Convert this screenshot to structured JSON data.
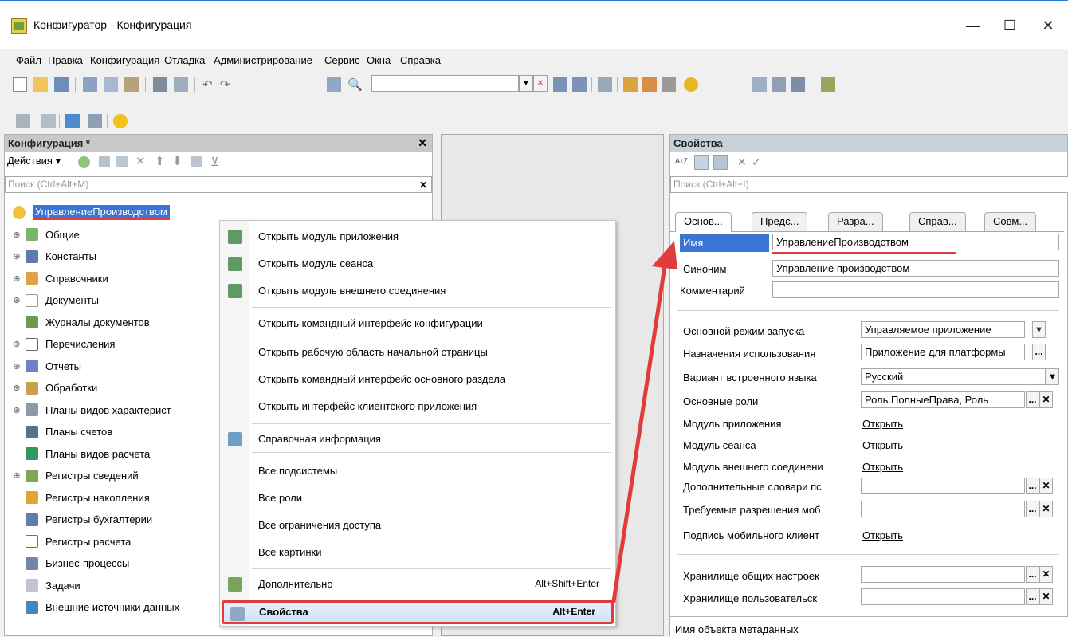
{
  "window": {
    "title": "Конфигуратор - Конфигурация",
    "minimize": "—",
    "maximize": "☐",
    "close": "✕"
  },
  "menu": [
    "Файл",
    "Правка",
    "Конфигурация",
    "Отладка",
    "Администрирование",
    "Сервис",
    "Окна",
    "Справка"
  ],
  "left": {
    "title": "Конфигурация *",
    "actions": "Действия ▾",
    "search_placeholder": "Поиск (Ctrl+Alt+M)",
    "root": "УправлениеПроизводством",
    "items": [
      "Общие",
      "Константы",
      "Справочники",
      "Документы",
      "Журналы документов",
      "Перечисления",
      "Отчеты",
      "Обработки",
      "Планы видов характерист",
      "Планы счетов",
      "Планы видов расчета",
      "Регистры сведений",
      "Регистры накопления",
      "Регистры бухгалтерии",
      "Регистры расчета",
      "Бизнес-процессы",
      "Задачи",
      "Внешние источники данных"
    ]
  },
  "context_menu": {
    "items": [
      {
        "label": "Открыть модуль приложения"
      },
      {
        "label": "Открыть модуль сеанса"
      },
      {
        "label": "Открыть модуль внешнего соединения"
      },
      {
        "label": "Открыть командный интерфейс конфигурации"
      },
      {
        "label": "Открыть рабочую область начальной страницы"
      },
      {
        "label": "Открыть командный интерфейс основного раздела"
      },
      {
        "label": "Открыть интерфейс клиентского приложения"
      },
      {
        "label": "Справочная информация"
      },
      {
        "label": "Все подсистемы"
      },
      {
        "label": "Все роли"
      },
      {
        "label": "Все ограничения доступа"
      },
      {
        "label": "Все картинки"
      },
      {
        "label": "Дополнительно",
        "shortcut": "Alt+Shift+Enter"
      },
      {
        "label": "Свойства",
        "shortcut": "Alt+Enter"
      }
    ]
  },
  "right": {
    "title": "Свойства",
    "search_placeholder": "Поиск (Ctrl+Alt+I)",
    "tabs": [
      "Основ...",
      "Предс...",
      "Разра...",
      "Справ...",
      "Совм..."
    ],
    "name_label": "Имя",
    "name_value": "УправлениеПроизводством",
    "synonym_label": "Синоним",
    "synonym_value": "Управление производством",
    "comment_label": "Комментарий",
    "props": [
      {
        "label": "Основной режим запуска",
        "value": "Управляемое приложение"
      },
      {
        "label": "Назначения использования",
        "value": "Приложение для платформы"
      },
      {
        "label": "Вариант встроенного языка",
        "value": "Русский"
      },
      {
        "label": "Основные роли",
        "value": "Роль.ПолныеПрава, Роль"
      },
      {
        "label": "Модуль приложения",
        "value": "Открыть"
      },
      {
        "label": "Модуль сеанса",
        "value": "Открыть"
      },
      {
        "label": "Модуль внешнего соединени",
        "value": "Открыть"
      },
      {
        "label": "Дополнительные словари пс",
        "value": ""
      },
      {
        "label": "Требуемые разрешения моб",
        "value": ""
      },
      {
        "label": "Подпись мобильного клиент",
        "value": "Открыть"
      },
      {
        "label": "Хранилище общих настроек",
        "value": ""
      },
      {
        "label": "Хранилище пользовательск",
        "value": ""
      }
    ],
    "status": "Имя объекта метаданных"
  },
  "colors": {
    "accent": "#e03c3c",
    "selection": "#3a74d4"
  }
}
